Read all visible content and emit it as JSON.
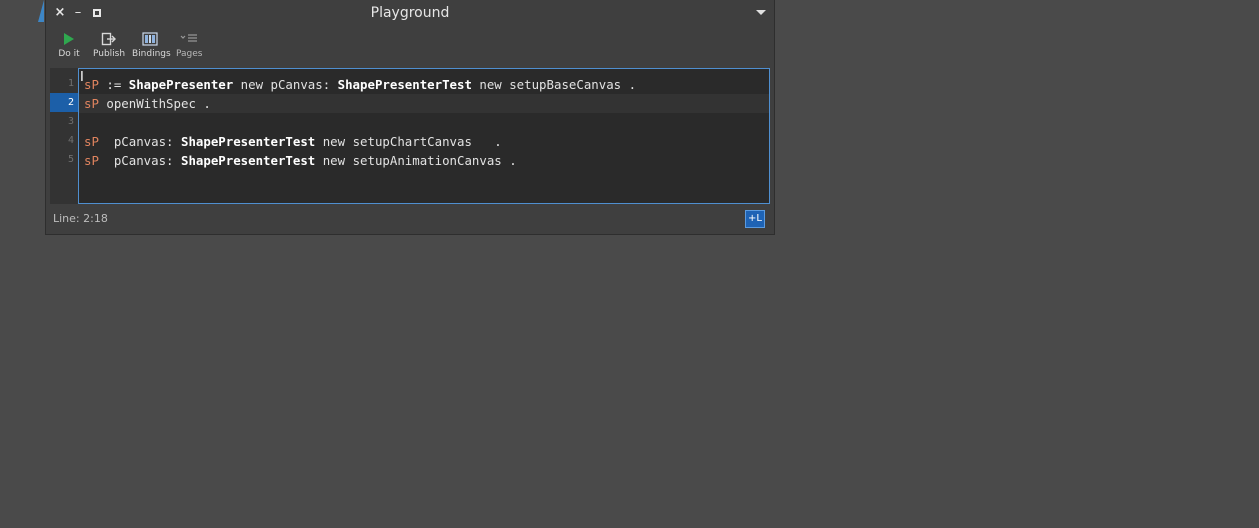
{
  "window": {
    "title": "Playground"
  },
  "toolbar": {
    "doit_label": "Do it",
    "publish_label": "Publish",
    "bindings_label": "Bindings",
    "pages_label": "Pages"
  },
  "editor": {
    "line_numbers": [
      "1",
      "2",
      "3",
      "4",
      "5"
    ],
    "current_line": "2",
    "lines": [
      [
        {
          "t": "sP",
          "c": "var"
        },
        {
          "t": " := ",
          "c": "kw"
        },
        {
          "t": "ShapePresenter",
          "c": "cls"
        },
        {
          "t": " new pCanvas: ",
          "c": "kw"
        },
        {
          "t": "ShapePresenterTest",
          "c": "cls"
        },
        {
          "t": " new setupBaseCanvas .",
          "c": "kw"
        }
      ],
      [
        {
          "t": "sP",
          "c": "var"
        },
        {
          "t": " openWithSpec .",
          "c": "kw"
        }
      ],
      [],
      [
        {
          "t": "sP",
          "c": "var"
        },
        {
          "t": "  pCanvas: ",
          "c": "kw"
        },
        {
          "t": "ShapePresenterTest",
          "c": "cls"
        },
        {
          "t": " new setupChartCanvas   .",
          "c": "kw"
        }
      ],
      [
        {
          "t": "sP",
          "c": "var"
        },
        {
          "t": "  pCanvas: ",
          "c": "kw"
        },
        {
          "t": "ShapePresenterTest",
          "c": "cls"
        },
        {
          "t": " new setupAnimationCanvas .",
          "c": "kw"
        }
      ]
    ]
  },
  "status": {
    "position": "Line: 2:18",
    "badge": "+L"
  },
  "colors": {
    "background": "#4a4a4a",
    "window": "#3f3f3f",
    "editor": "#2a2a2a",
    "variable": "#e0845f",
    "accent": "#1e63b5"
  }
}
